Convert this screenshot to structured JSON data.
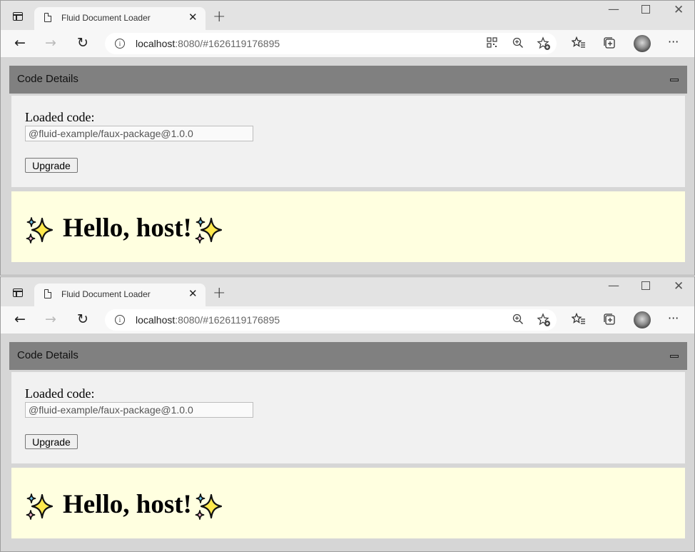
{
  "windows": [
    {
      "tab": {
        "title": "Fluid Document Loader",
        "close": "✕"
      },
      "new_tab": "+",
      "controls": {
        "minimize": "—",
        "close": "✕"
      },
      "nav": {
        "back": "←",
        "forward": "→",
        "reload": "↻",
        "more": "···"
      },
      "address": {
        "info": "i",
        "host": "localhost",
        "rest": ":8080/#1626119176895"
      },
      "addr_icons": [
        "qr-code-icon",
        "zoom-icon",
        "add-favorite-icon"
      ],
      "app": {
        "header_title": "Code Details",
        "loaded_label": "Loaded code:",
        "loaded_value": "@fluid-example/faux-package@1.0.0",
        "upgrade_label": "Upgrade",
        "hello_text": "Hello, host!"
      }
    },
    {
      "tab": {
        "title": "Fluid Document Loader",
        "close": "✕"
      },
      "new_tab": "+",
      "controls": {
        "minimize": "—",
        "close": "✕"
      },
      "nav": {
        "back": "←",
        "forward": "→",
        "reload": "↻",
        "more": "···"
      },
      "address": {
        "info": "i",
        "host": "localhost",
        "rest": ":8080/#1626119176895"
      },
      "addr_icons": [
        "zoom-icon",
        "add-favorite-icon"
      ],
      "app": {
        "header_title": "Code Details",
        "loaded_label": "Loaded code:",
        "loaded_value": "@fluid-example/faux-package@1.0.0",
        "upgrade_label": "Upgrade",
        "hello_text": "Hello, host!"
      }
    }
  ],
  "colors": {
    "header_bg": "#808080",
    "content_bg": "#d6d6d6",
    "details_bg": "#f1f1f1",
    "hello_bg": "#ffffe0",
    "sparkle_yellow": "#ffe94d",
    "sparkle_blue": "#6ec6ee",
    "sparkle_pink": "#f7b7d2"
  }
}
